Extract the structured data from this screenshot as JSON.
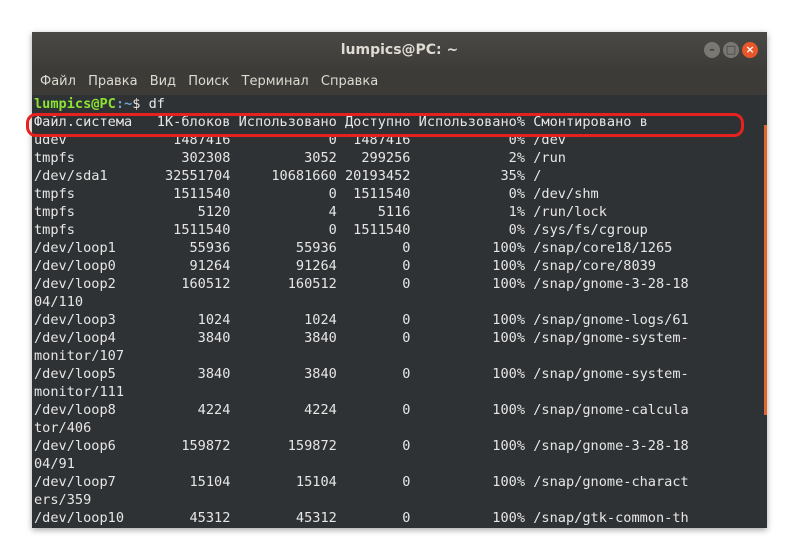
{
  "window": {
    "title": "lumpics@PC: ~",
    "controls": [
      "minimize-icon",
      "maximize-icon",
      "close-icon"
    ],
    "colors": {
      "close": "#e9562a",
      "titlebar": "#3d3c39",
      "terminal_bg": "#2f3234",
      "highlight": "#e5221d"
    }
  },
  "menu": [
    "Файл",
    "Правка",
    "Вид",
    "Поиск",
    "Терминал",
    "Справка"
  ],
  "prompt": {
    "user": "lumpics@PC",
    "path": ":~",
    "symbol": "$ ",
    "command": "df"
  },
  "header": "Файл.система   1К-блоков Использовано Доступно Использовано% Смонтировано в",
  "lines": [
    "udev             1487416            0  1487416            0% /dev",
    "tmpfs             302308         3052   299256            2% /run",
    "/dev/sda1       32551704     10681660 20193452           35% /",
    "tmpfs            1511540            0  1511540            0% /dev/shm",
    "tmpfs               5120            4     5116            1% /run/lock",
    "tmpfs            1511540            0  1511540            0% /sys/fs/cgroup",
    "/dev/loop1         55936        55936        0          100% /snap/core18/1265",
    "/dev/loop0         91264        91264        0          100% /snap/core/8039",
    "/dev/loop2        160512       160512        0          100% /snap/gnome-3-28-18",
    "04/110",
    "/dev/loop3          1024         1024        0          100% /snap/gnome-logs/61",
    "/dev/loop4          3840         3840        0          100% /snap/gnome-system-",
    "monitor/107",
    "/dev/loop5          3840         3840        0          100% /snap/gnome-system-",
    "monitor/111",
    "/dev/loop8          4224         4224        0          100% /snap/gnome-calcula",
    "tor/406",
    "/dev/loop6        159872       159872        0          100% /snap/gnome-3-28-18",
    "04/91",
    "/dev/loop7         15104        15104        0          100% /snap/gnome-charact",
    "ers/359",
    "/dev/loop10        45312        45312        0          100% /snap/gtk-common-th"
  ]
}
